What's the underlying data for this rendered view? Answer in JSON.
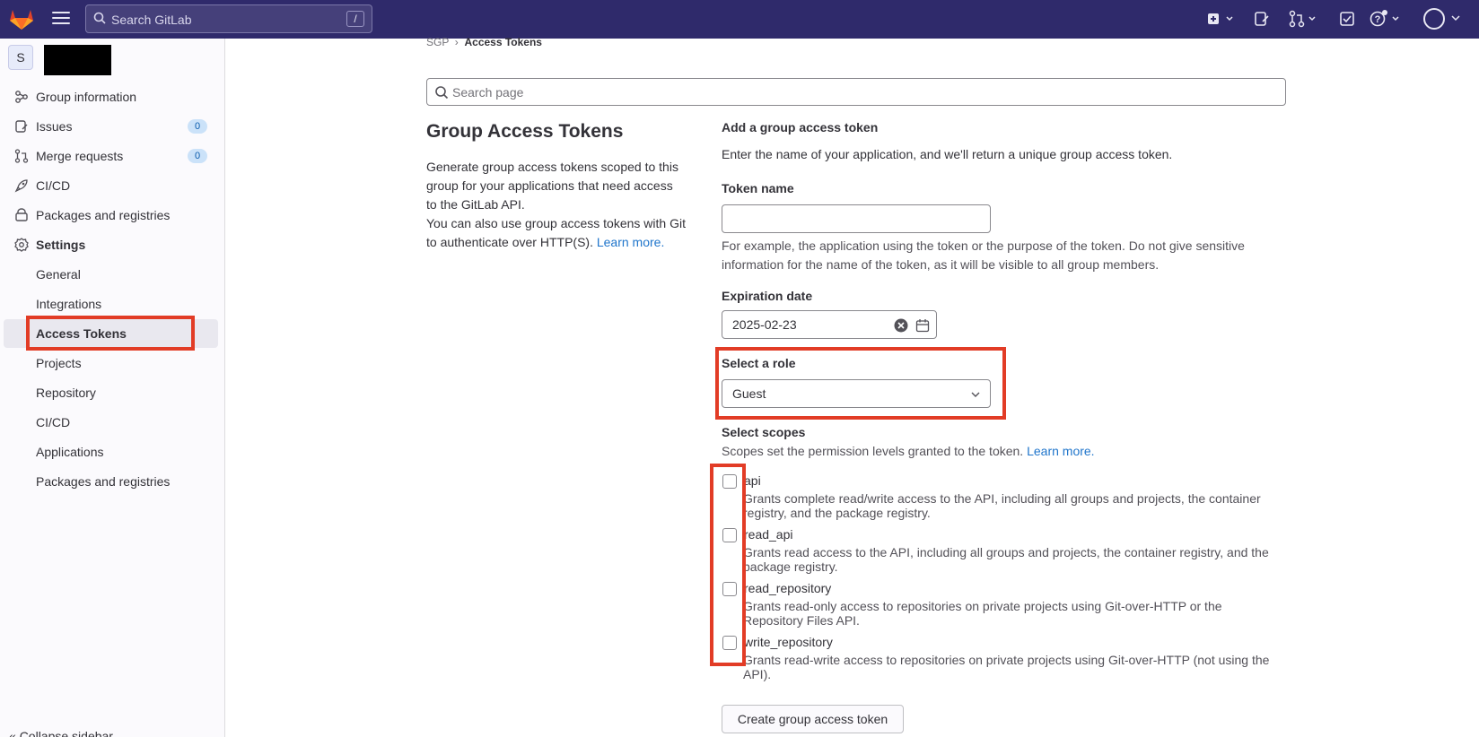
{
  "topbar": {
    "search_placeholder": "Search GitLab",
    "search_shortcut": "/",
    "icons": [
      "create-new-icon",
      "issues-icon",
      "merge-requests-icon",
      "todos-icon",
      "help-icon",
      "user-avatar"
    ]
  },
  "sidebar": {
    "group_initial": "S",
    "items": [
      {
        "label": "Group information",
        "icon": "group-info-icon"
      },
      {
        "label": "Issues",
        "icon": "issues-icon",
        "badge": "0"
      },
      {
        "label": "Merge requests",
        "icon": "merge-request-icon",
        "badge": "0"
      },
      {
        "label": "CI/CD",
        "icon": "rocket-icon"
      },
      {
        "label": "Packages and registries",
        "icon": "package-icon"
      },
      {
        "label": "Settings",
        "icon": "settings-icon"
      },
      {
        "label": "General"
      },
      {
        "label": "Integrations"
      },
      {
        "label": "Access Tokens"
      },
      {
        "label": "Projects"
      },
      {
        "label": "Repository"
      },
      {
        "label": "CI/CD"
      },
      {
        "label": "Applications"
      },
      {
        "label": "Packages and registries"
      }
    ],
    "collapse_label": "Collapse sidebar"
  },
  "breadcrumb": {
    "parent": "SGP",
    "current": "Access Tokens"
  },
  "page_search_placeholder": "Search page",
  "left": {
    "title": "Group Access Tokens",
    "desc1": "Generate group access tokens scoped to this group for your applications that need access to the GitLab API.",
    "desc2": "You can also use group access tokens with Git to authenticate over HTTP(S).",
    "learn_more": "Learn more."
  },
  "form": {
    "heading": "Add a group access token",
    "intro": "Enter the name of your application, and we'll return a unique group access token.",
    "token_name_label": "Token name",
    "token_name_value": "",
    "token_name_help": "For example, the application using the token or the purpose of the token. Do not give sensitive information for the name of the token, as it will be visible to all group members.",
    "expiration_label": "Expiration date",
    "expiration_value": "2025-02-23",
    "role_label": "Select a role",
    "role_value": "Guest",
    "scopes_label": "Select scopes",
    "scopes_help": "Scopes set the permission levels granted to the token.",
    "scopes_learn_more": "Learn more.",
    "scopes": [
      {
        "name": "api",
        "desc": "Grants complete read/write access to the API, including all groups and projects, the container registry, and the package registry.",
        "checked": false
      },
      {
        "name": "read_api",
        "desc": "Grants read access to the API, including all groups and projects, the container registry, and the package registry.",
        "checked": false
      },
      {
        "name": "read_repository",
        "desc": "Grants read-only access to repositories on private projects using Git-over-HTTP or the Repository Files API.",
        "checked": false
      },
      {
        "name": "write_repository",
        "desc": "Grants read-write access to repositories on private projects using Git-over-HTTP (not using the API).",
        "checked": false
      }
    ],
    "submit_label": "Create group access token"
  },
  "colors": {
    "topbar": "#2f2a6b",
    "link": "#1f75cb",
    "highlight": "#e23c26"
  }
}
